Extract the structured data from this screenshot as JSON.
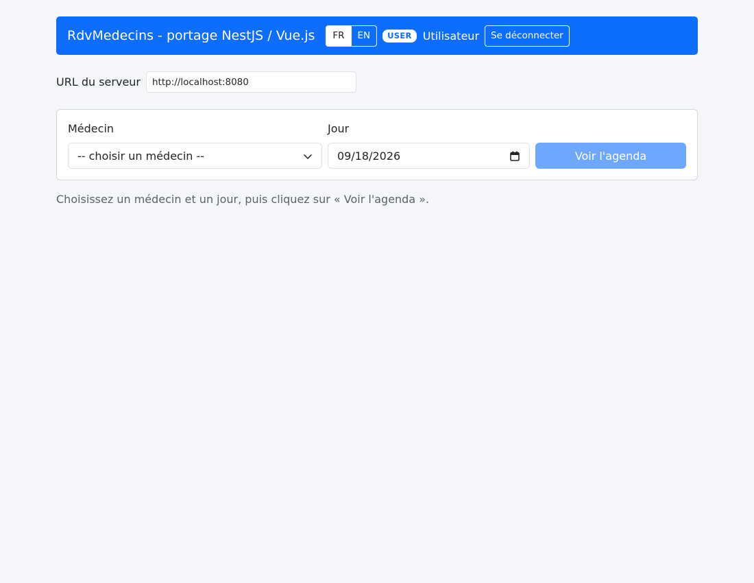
{
  "header": {
    "title": "RdvMedecins - portage NestJS / Vue.js",
    "languages": [
      {
        "label": "FR",
        "active": true
      },
      {
        "label": "EN",
        "active": false
      }
    ],
    "role_badge": "USER",
    "user_name": "Utilisateur",
    "logout_label": "Se déconnecter",
    "brand_color": "#0d6efd"
  },
  "server": {
    "label": "URL du serveur",
    "value": "http://localhost:8080"
  },
  "search": {
    "doctor_label": "Médecin",
    "doctor_selected": "-- choisir un médecin --",
    "day_label": "Jour",
    "day_value": "09/18/2026",
    "submit_label": "Voir l'agenda",
    "submit_disabled": true
  },
  "hint": "Choisissez un médecin et un jour, puis cliquez sur « Voir l'agenda »."
}
